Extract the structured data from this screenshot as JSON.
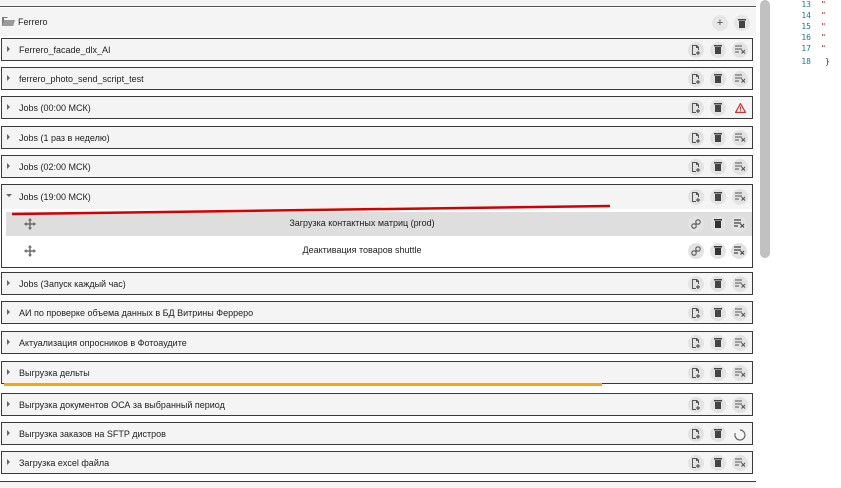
{
  "folder": {
    "title": "Ferrero"
  },
  "rows_top": [
    {
      "label": "Ferrero_facade_dlx_AI",
      "status": "clear"
    },
    {
      "label": "ferrero_photo_send_script_test",
      "status": "clear"
    },
    {
      "label": "Jobs (00:00 МСК)",
      "status": "warning"
    },
    {
      "label": "Jobs (1 раз в неделю)",
      "status": "clear"
    },
    {
      "label": "Jobs (02:00 МСК)",
      "status": "clear"
    }
  ],
  "expanded": {
    "label": "Jobs (19:00 МСК)",
    "children": [
      {
        "label": "Загрузка контактных матриц (prod)"
      },
      {
        "label": "Деактивация товаров shuttle"
      }
    ]
  },
  "rows_bottom": [
    {
      "label": "Jobs (Запуск каждый час)",
      "status": "clear"
    },
    {
      "label": "АИ по проверке объема данных в БД Витрины Ферреро",
      "status": "clear"
    },
    {
      "label": "Актуализация опросников в Фотоаудите",
      "status": "clear"
    },
    {
      "label": "Выгрузка дельты",
      "status": "clear"
    },
    {
      "label": "Выгрузка документов ОСА за выбранный период",
      "status": "clear"
    },
    {
      "label": "Выгрузка заказов на SFTP дистров",
      "status": "loading"
    },
    {
      "label": "Загрузка excel файла",
      "status": "clear"
    }
  ],
  "code_panel": {
    "line_numbers": [
      "13",
      "14",
      "15",
      "16",
      "17",
      "18"
    ],
    "closing_brace": "}"
  },
  "colors": {
    "annotation_red": "#d40000",
    "annotation_orange": "#f0a81a",
    "warning": "#d32f2f"
  }
}
